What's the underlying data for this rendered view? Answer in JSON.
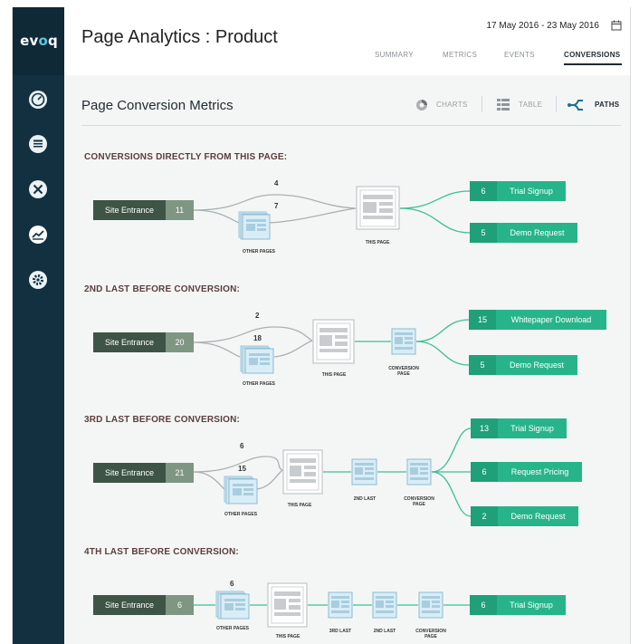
{
  "app": {
    "logo_prefix": "ev",
    "logo_mid": "o",
    "logo_suffix": "q"
  },
  "header": {
    "title": "Page Analytics : Product",
    "date_range": "17 May 2016 - 23 May 2016",
    "tabs": [
      {
        "label": "SUMMARY"
      },
      {
        "label": "METRICS"
      },
      {
        "label": "EVENTS"
      },
      {
        "label": "CONVERSIONS",
        "active": true
      }
    ]
  },
  "sidebar": {
    "items": [
      {
        "icon": "dashboard-icon"
      },
      {
        "icon": "content-icon"
      },
      {
        "icon": "tools-icon"
      },
      {
        "icon": "analytics-icon",
        "active": true
      },
      {
        "icon": "settings-icon"
      }
    ]
  },
  "section": {
    "title": "Page Conversion Metrics",
    "views": {
      "charts": "CHARTS",
      "table": "TABLE",
      "paths": "PATHS"
    }
  },
  "labels": {
    "site_entrance": "Site Entrance",
    "other_pages": "OTHER PAGES",
    "this_page": "THIS PAGE",
    "conversion_page_1": "CONVERSION",
    "conversion_page_2": "PAGE",
    "second_last": "2ND LAST",
    "third_last": "3RD LAST"
  },
  "groups": [
    {
      "title": "CONVERSIONS DIRECTLY FROM THIS PAGE:",
      "entrance_count": "11",
      "direct_count": "4",
      "other_count": "7",
      "conversions": [
        {
          "count": "6",
          "label": "Trial Signup"
        },
        {
          "count": "5",
          "label": "Demo Request"
        }
      ]
    },
    {
      "title": "2ND LAST BEFORE CONVERSION:",
      "entrance_count": "20",
      "direct_count": "2",
      "other_count": "18",
      "conversions": [
        {
          "count": "15",
          "label": "Whitepaper Download"
        },
        {
          "count": "5",
          "label": "Demo Request"
        }
      ]
    },
    {
      "title": "3RD LAST BEFORE CONVERSION:",
      "entrance_count": "21",
      "direct_count": "6",
      "other_count": "15",
      "conversions": [
        {
          "count": "13",
          "label": "Trial Signup"
        },
        {
          "count": "6",
          "label": "Request Pricing"
        },
        {
          "count": "2",
          "label": "Demo Request"
        }
      ]
    },
    {
      "title": "4TH LAST BEFORE CONVERSION:",
      "entrance_count": "6",
      "other_count": "6",
      "conversions": [
        {
          "count": "6",
          "label": "Trial Signup"
        }
      ]
    }
  ],
  "colors": {
    "sidebar_bg": "#133040",
    "entrance_dark": "#3d5446",
    "entrance_light": "#7f9682",
    "conversion_green": "#27b48a",
    "flow_line": "#3cbf96",
    "gray_line": "#a9b0b3",
    "page_blue": "#cfe6f1"
  }
}
